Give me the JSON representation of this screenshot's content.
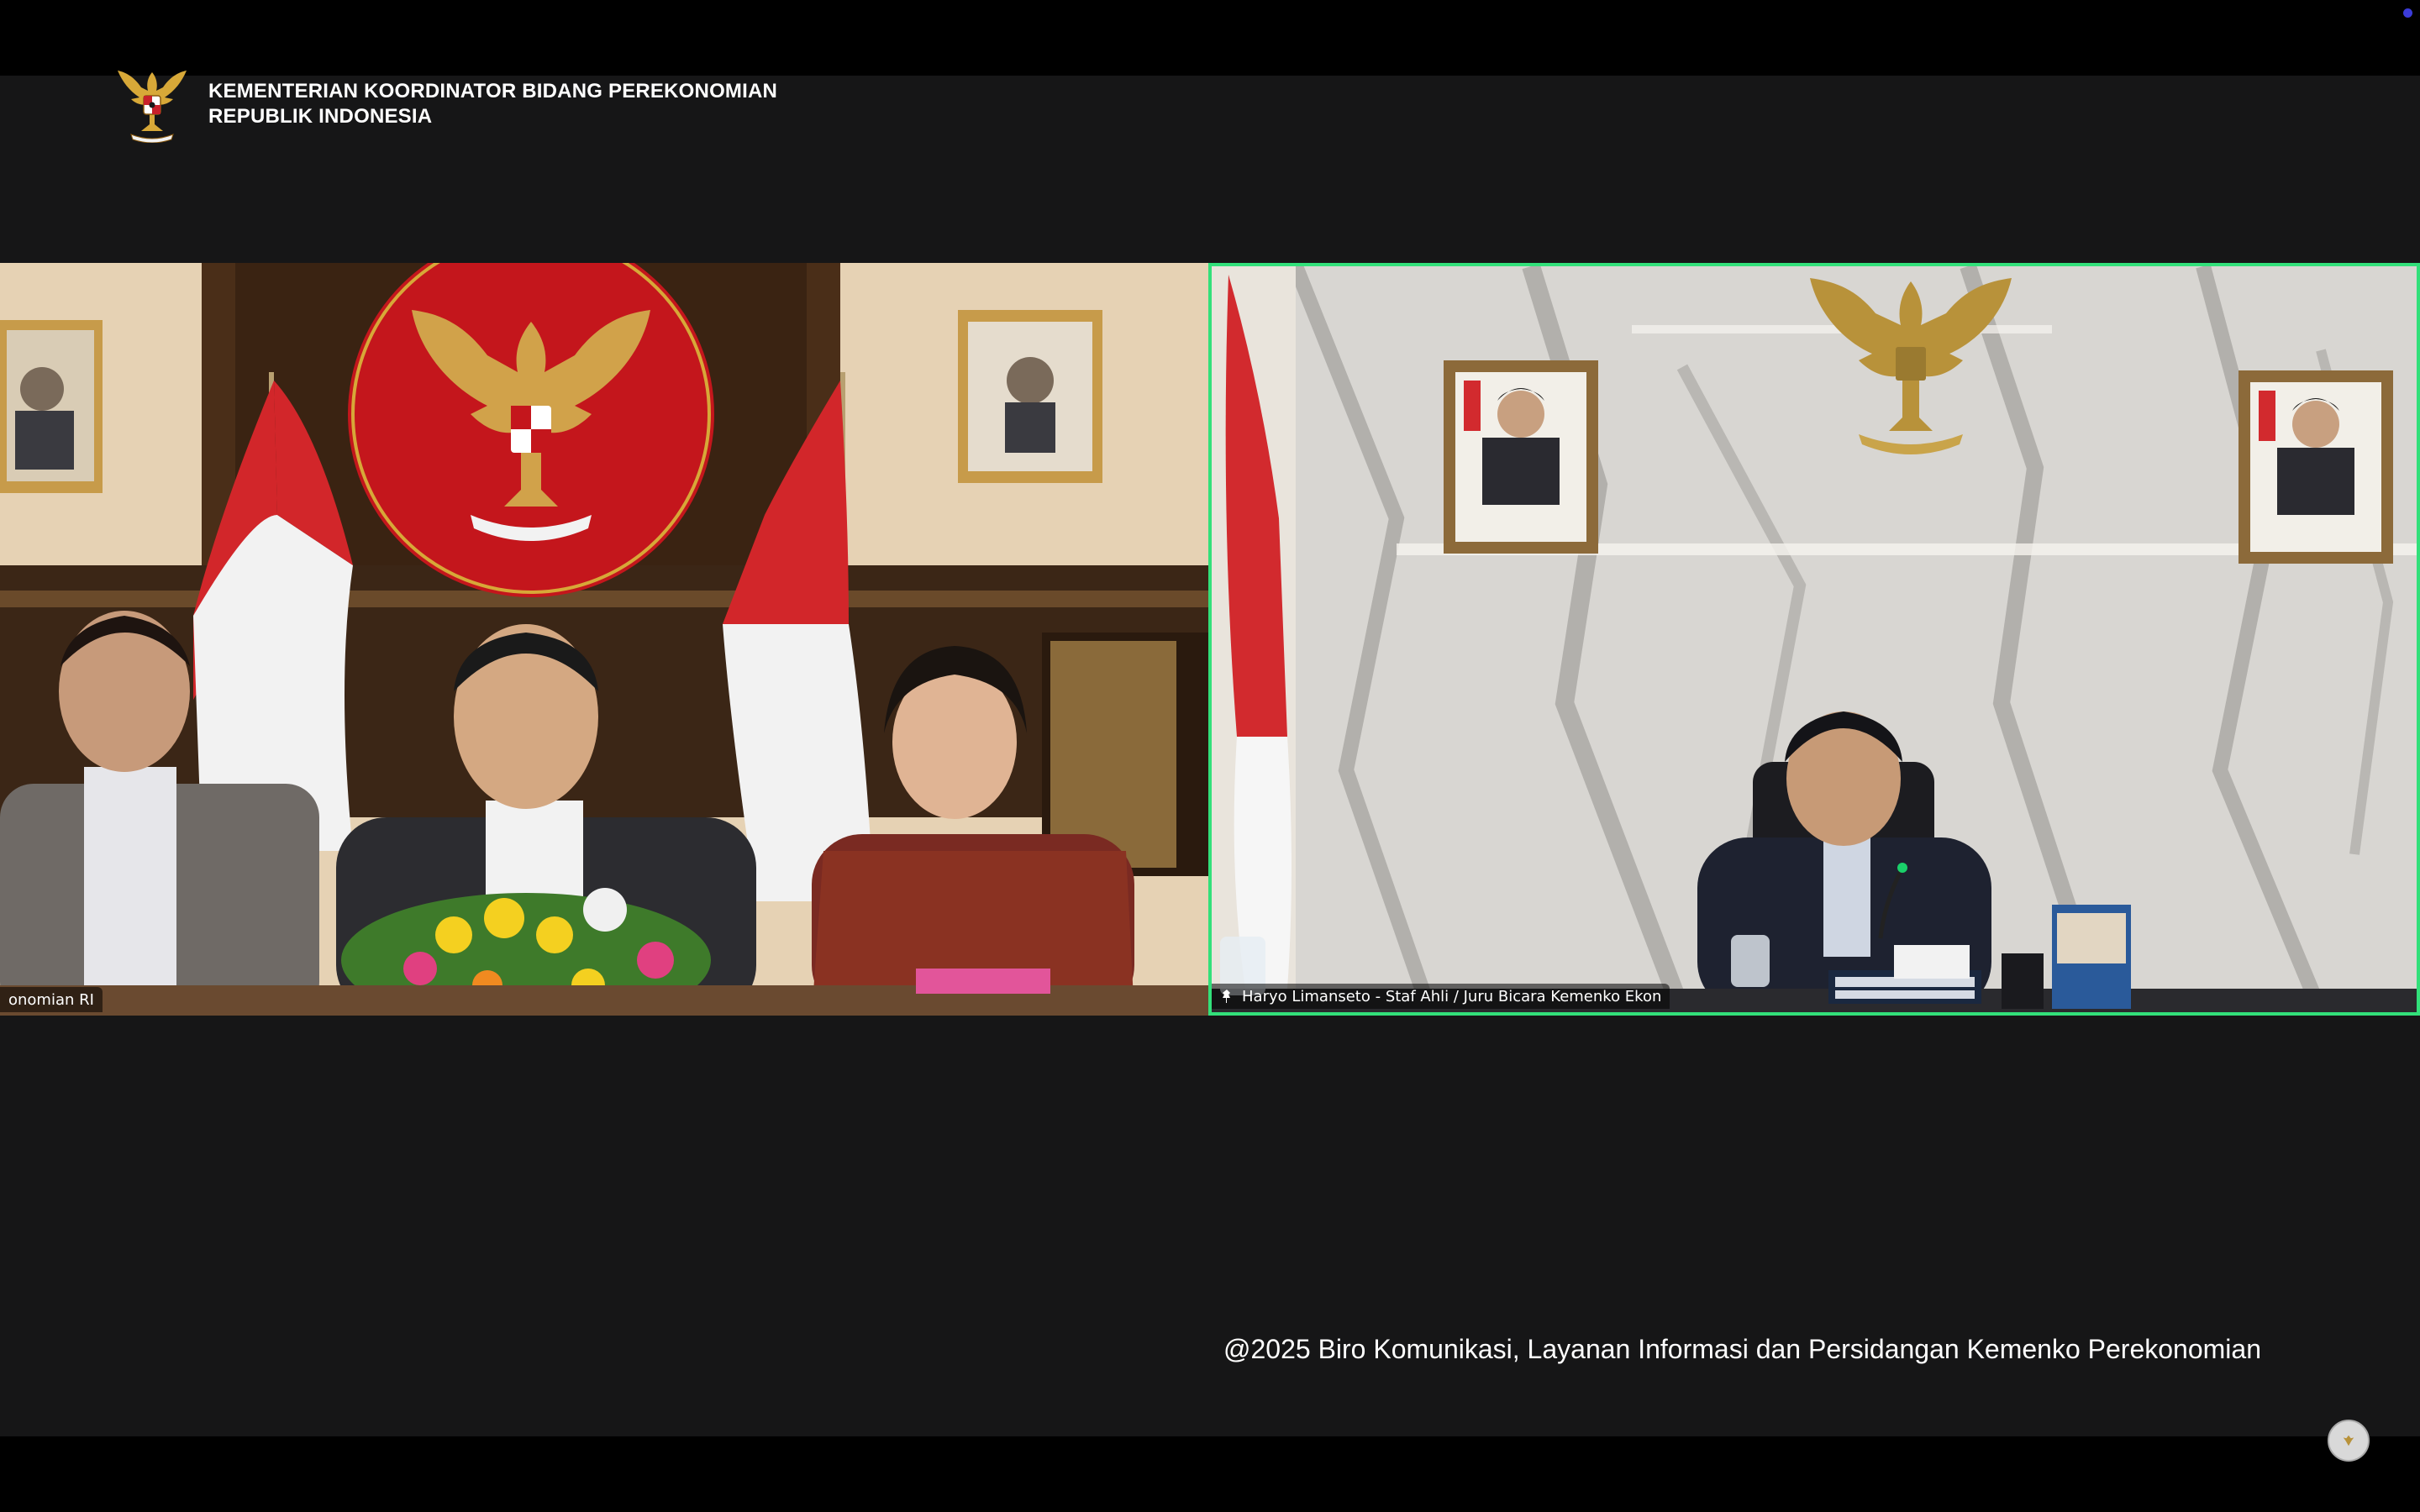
{
  "header": {
    "org_line_1": "KEMENTERIAN KOORDINATOR BIDANG PEREKONOMIAN",
    "org_line_2": "REPUBLIK INDONESIA",
    "emblem_icon": "garuda-emblem-icon"
  },
  "participants": [
    {
      "name_label": "onomian RI",
      "active_speaker": false
    },
    {
      "name_label": "Haryo Limanseto - Staf Ahli / Juru Bicara Kemenko Ekon",
      "active_speaker": true,
      "pin_icon": "pin-icon"
    }
  ],
  "footer": {
    "caption": "@2025 Biro Komunikasi, Layanan Informasi dan Persidangan Kemenko Perekonomian"
  },
  "colors": {
    "background": "#161617",
    "letterbox": "#000000",
    "active_speaker_border": "#32e07a",
    "text": "#ffffff"
  }
}
